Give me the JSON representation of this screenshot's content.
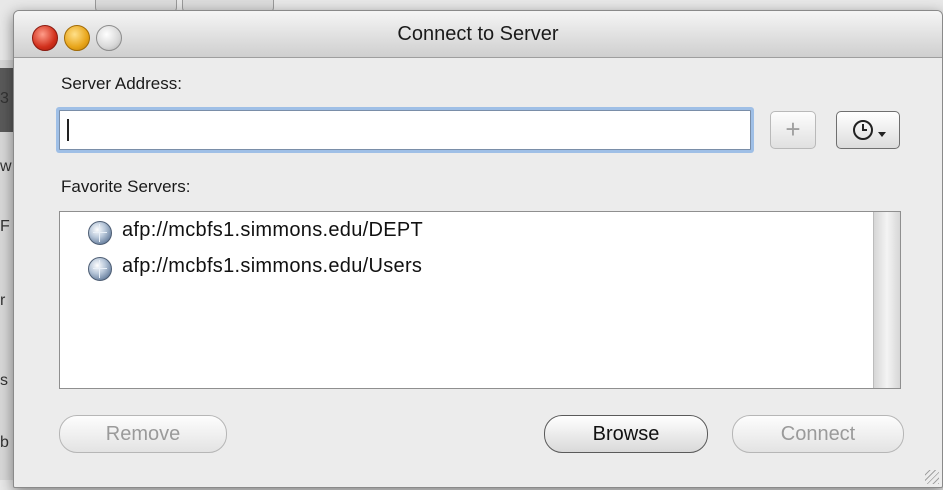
{
  "window": {
    "title": "Connect to Server"
  },
  "background": {
    "edge_letters": [
      "3",
      "w",
      "F",
      "r",
      "s",
      "b"
    ]
  },
  "server_address": {
    "label": "Server Address:",
    "value": "",
    "add_label": "+"
  },
  "favorites": {
    "label": "Favorite Servers:",
    "items": [
      {
        "label": "afp://mcbfs1.simmons.edu/DEPT",
        "icon": "globe-icon"
      },
      {
        "label": "afp://mcbfs1.simmons.edu/Users",
        "icon": "globe-icon"
      }
    ]
  },
  "buttons": {
    "remove_label": "Remove",
    "browse_label": "Browse",
    "connect_label": "Connect"
  },
  "colors": {
    "focus_ring": "#9fbfe6",
    "close": "#d1301c",
    "minimize": "#e8a51a",
    "zoom": "#d8d8d8"
  }
}
